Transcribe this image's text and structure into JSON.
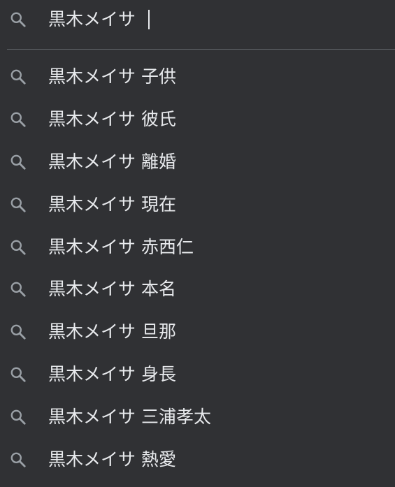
{
  "search": {
    "query": "黒木メイサ",
    "icon": "search-icon"
  },
  "colors": {
    "background": "#303134",
    "text": "#e8eaed",
    "icon": "#9aa0a6",
    "divider": "#5f6368"
  },
  "suggestions": [
    {
      "label": "黒木メイサ 子供",
      "icon": "search-icon"
    },
    {
      "label": "黒木メイサ 彼氏",
      "icon": "search-icon"
    },
    {
      "label": "黒木メイサ 離婚",
      "icon": "search-icon"
    },
    {
      "label": "黒木メイサ 現在",
      "icon": "search-icon"
    },
    {
      "label": "黒木メイサ 赤西仁",
      "icon": "search-icon"
    },
    {
      "label": "黒木メイサ 本名",
      "icon": "search-icon"
    },
    {
      "label": "黒木メイサ 旦那",
      "icon": "search-icon"
    },
    {
      "label": "黒木メイサ 身長",
      "icon": "search-icon"
    },
    {
      "label": "黒木メイサ 三浦孝太",
      "icon": "search-icon"
    },
    {
      "label": "黒木メイサ 熱愛",
      "icon": "search-icon"
    }
  ]
}
